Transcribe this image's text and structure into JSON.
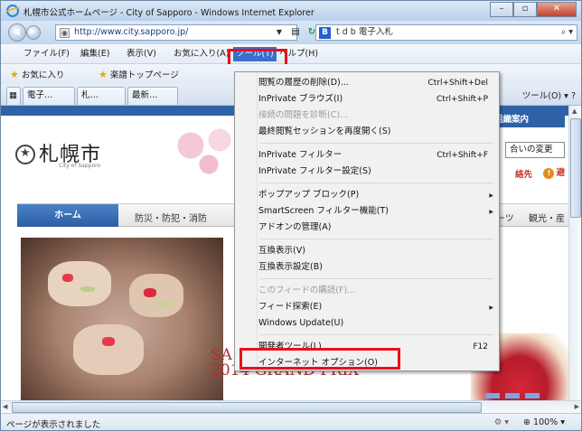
{
  "window": {
    "title": "札幌市公式ホームページ - City of Sapporo - Windows Internet Explorer"
  },
  "address": {
    "url": "http://www.city.sapporo.jp/"
  },
  "search": {
    "text": "t d b  電子入札"
  },
  "menubar": [
    "ファイル(F)",
    "編集(E)",
    "表示(V)",
    "お気に入り(A)",
    "ツール(T)",
    "ヘルプ(H)"
  ],
  "favorites": {
    "label": "お気に入り",
    "link": "楽譜トップページ"
  },
  "tabs": [
    "電子…",
    "札…",
    "最新…"
  ],
  "tabtools": {
    "tools": "ツール(O)"
  },
  "content": {
    "org_button": "組織案内",
    "logo_main": "札幌市",
    "logo_sub": "City of Sapporo",
    "contact_box": "合いの変更",
    "link_left": "絡先",
    "link_right": "避",
    "nav_home": "ホーム",
    "nav_items": [
      "防災・防犯・消防",
      "ーツ",
      "観光・産"
    ],
    "banner_line1": "SA",
    "banner_line2": "2014 GRAND PRIX"
  },
  "status": {
    "text": "ページが表示されました",
    "zoom": "100%"
  },
  "tools_menu": {
    "items": [
      {
        "label": "閲覧の履歴の削除(D)...",
        "shortcut": "Ctrl+Shift+Del",
        "disabled": false,
        "submenu": false
      },
      {
        "label": "InPrivate ブラウズ(I)",
        "shortcut": "Ctrl+Shift+P",
        "disabled": false,
        "submenu": false
      },
      {
        "label": "接続の問題を診断(C)...",
        "shortcut": "",
        "disabled": true,
        "submenu": false
      },
      {
        "label": "最終閲覧セッションを再度開く(S)",
        "shortcut": "",
        "disabled": false,
        "submenu": false
      },
      {
        "label": "InPrivate フィルター",
        "shortcut": "Ctrl+Shift+F",
        "disabled": false,
        "submenu": false
      },
      {
        "label": "InPrivate フィルター設定(S)",
        "shortcut": "",
        "disabled": false,
        "submenu": false
      },
      {
        "label": "ポップアップ ブロック(P)",
        "shortcut": "",
        "disabled": false,
        "submenu": true
      },
      {
        "label": "SmartScreen フィルター機能(T)",
        "shortcut": "",
        "disabled": false,
        "submenu": true
      },
      {
        "label": "アドオンの管理(A)",
        "shortcut": "",
        "disabled": false,
        "submenu": false
      },
      {
        "label": "互換表示(V)",
        "shortcut": "",
        "disabled": false,
        "submenu": false
      },
      {
        "label": "互換表示設定(B)",
        "shortcut": "",
        "disabled": false,
        "submenu": false
      },
      {
        "label": "このフィードの購読(F)...",
        "shortcut": "",
        "disabled": true,
        "submenu": false
      },
      {
        "label": "フィード探索(E)",
        "shortcut": "",
        "disabled": false,
        "submenu": true
      },
      {
        "label": "Windows Update(U)",
        "shortcut": "",
        "disabled": false,
        "submenu": false
      },
      {
        "label": "開発者ツール(L)",
        "shortcut": "F12",
        "disabled": false,
        "submenu": false
      },
      {
        "label": "インターネット オプション(O)",
        "shortcut": "",
        "disabled": false,
        "submenu": false
      }
    ]
  },
  "colors": {
    "highlight_box": "#e8101c",
    "menu_active": "#3b6fc9"
  }
}
